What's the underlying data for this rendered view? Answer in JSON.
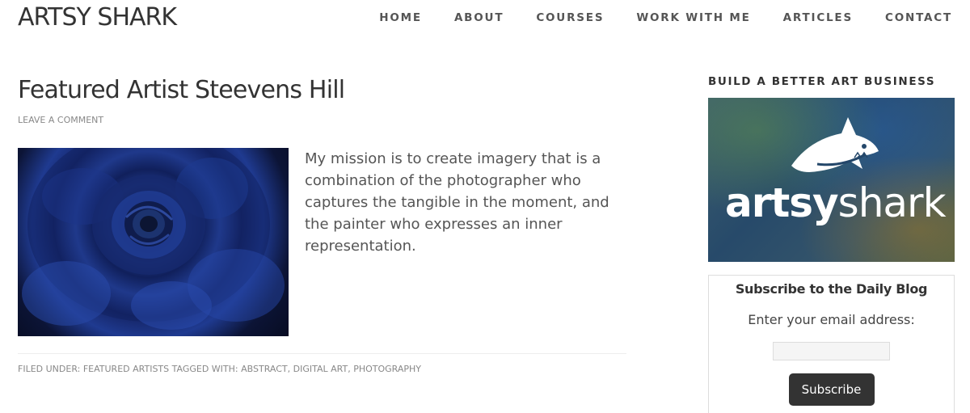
{
  "site": {
    "title": "ARTSY SHARK"
  },
  "nav": {
    "items": [
      "HOME",
      "ABOUT",
      "COURSES",
      "WORK WITH ME",
      "ARTICLES",
      "CONTACT"
    ]
  },
  "post": {
    "title": "Featured Artist Steevens Hill",
    "meta": "LEAVE A COMMENT",
    "body": "My mission is to create imagery that is a combination of the photographer who captures the tangible in the moment, and the painter who expresses an inner representation.",
    "footer": {
      "filed_label": "FILED UNDER:",
      "category": "FEATURED ARTISTS",
      "tagged_label": "TAGGED WITH:",
      "tags": [
        "ABSTRACT",
        "DIGITAL ART",
        "PHOTOGRAPHY"
      ]
    }
  },
  "sidebar": {
    "widget_title": "BUILD A BETTER ART BUSINESS",
    "banner": {
      "brand_bold": "artsy",
      "brand_light": "shark"
    },
    "subscribe": {
      "title": "Subscribe to the Daily Blog",
      "label": "Enter your email address:",
      "input_value": "",
      "button": "Subscribe"
    }
  }
}
